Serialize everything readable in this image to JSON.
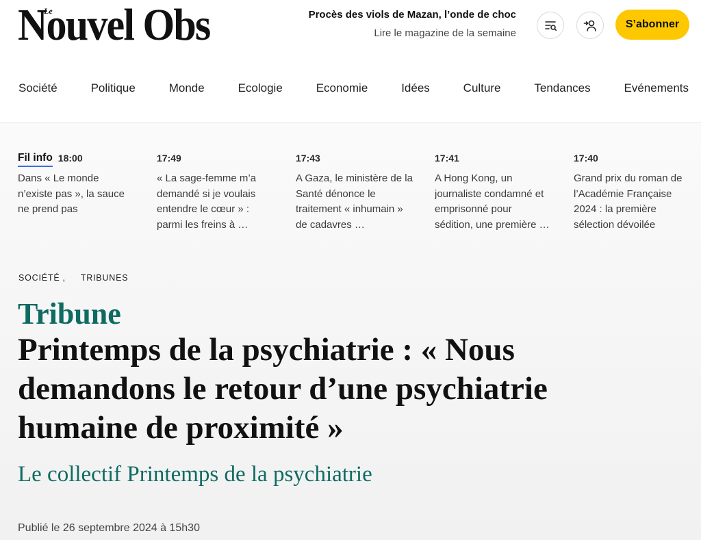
{
  "header": {
    "logo": {
      "prefix": "Le",
      "name": "Nouvel Obs"
    },
    "promo": {
      "headline": "Procès des viols de Mazan, l’onde de choc",
      "magazine_link": "Lire le magazine de la semaine"
    },
    "icons": {
      "search": "search-menu-icon",
      "account": "user-login-icon"
    },
    "subscribe_label": "S’abonner"
  },
  "nav": {
    "items": [
      "Société",
      "Politique",
      "Monde",
      "Ecologie",
      "Economie",
      "Idées",
      "Culture",
      "Tendances",
      "Evénements"
    ]
  },
  "fil_info": {
    "label": "Fil info",
    "items": [
      {
        "time": "18:00",
        "text": "Dans « Le monde n’existe pas », la sauce ne prend pas"
      },
      {
        "time": "17:49",
        "text": "« La sage-femme m’a demandé si je voulais entendre le cœur » : parmi les freins à …"
      },
      {
        "time": "17:43",
        "text": "A Gaza, le ministère de la Santé dénonce le traitement « inhumain » de cadavres …"
      },
      {
        "time": "17:41",
        "text": "A Hong Kong, un journaliste condamné et emprisonné pour sédition, une première …"
      },
      {
        "time": "17:40",
        "text": "Grand prix du roman de l’Académie Française 2024 : la première sélection dévoilée"
      }
    ]
  },
  "article": {
    "breadcrumb": {
      "items": [
        "SOCIÉTÉ",
        "TRIBUNES"
      ],
      "separator": ","
    },
    "kicker": "Tribune",
    "title": "Printemps de la psychiatrie : « Nous demandons le retour d’une psychiatrie humaine de proximité »",
    "author": "Le collectif Printemps de la psychiatrie",
    "published": "Publié le 26 septembre 2024 à 15h30"
  },
  "colors": {
    "accent_teal": "#0e6b62",
    "subscribe_yellow": "#fdc800",
    "fil_info_underline": "#3d6fd8",
    "text": "#1a1a1a"
  }
}
